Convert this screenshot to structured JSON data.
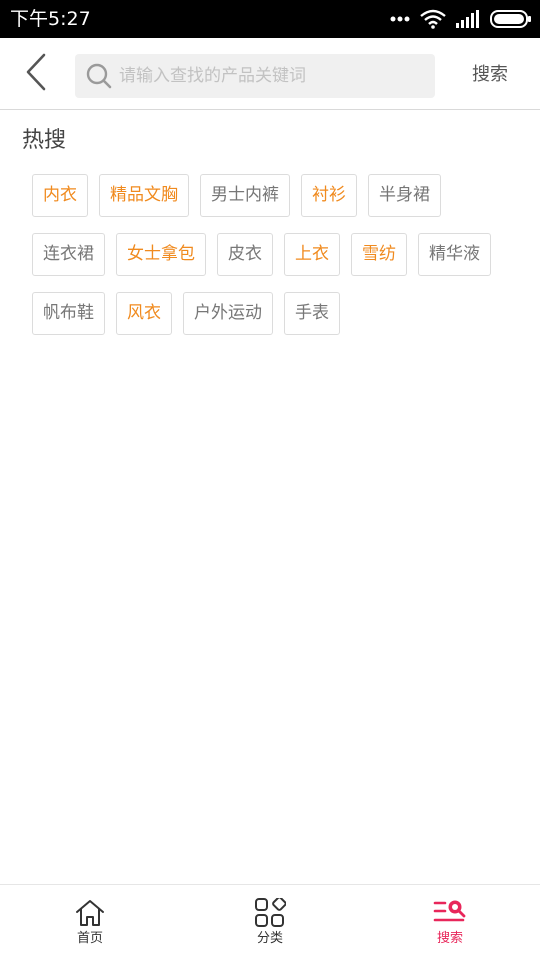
{
  "status_bar": {
    "time": "下午5:27",
    "icons": [
      "more-dots-icon",
      "wifi-icon",
      "signal-icon",
      "battery-icon"
    ]
  },
  "header": {
    "back_icon": "chevron-left-icon",
    "search_placeholder": "请输入查找的产品关键词",
    "search_value": "",
    "search_button_label": "搜索"
  },
  "hot_search": {
    "title": "热搜",
    "tags": [
      {
        "label": "内衣",
        "highlight": true
      },
      {
        "label": "精品文胸",
        "highlight": true
      },
      {
        "label": "男士内裤",
        "highlight": false
      },
      {
        "label": "衬衫",
        "highlight": true
      },
      {
        "label": "半身裙",
        "highlight": false
      },
      {
        "label": "连衣裙",
        "highlight": false
      },
      {
        "label": "女士拿包",
        "highlight": true
      },
      {
        "label": "皮衣",
        "highlight": false
      },
      {
        "label": "上衣",
        "highlight": true
      },
      {
        "label": "雪纺",
        "highlight": true
      },
      {
        "label": "精华液",
        "highlight": false
      },
      {
        "label": "帆布鞋",
        "highlight": false
      },
      {
        "label": "风衣",
        "highlight": true
      },
      {
        "label": "户外运动",
        "highlight": false
      },
      {
        "label": "手表",
        "highlight": false
      }
    ]
  },
  "bottom_nav": {
    "items": [
      {
        "label": "首页",
        "icon": "home-icon",
        "active": false
      },
      {
        "label": "分类",
        "icon": "category-grid-icon",
        "active": false
      },
      {
        "label": "搜索",
        "icon": "search-list-icon",
        "active": true
      }
    ]
  },
  "colors": {
    "accent_orange": "#f08a1e",
    "active_pink": "#e8265a",
    "tag_text_gray": "#777777",
    "status_bar_bg": "#000000"
  }
}
